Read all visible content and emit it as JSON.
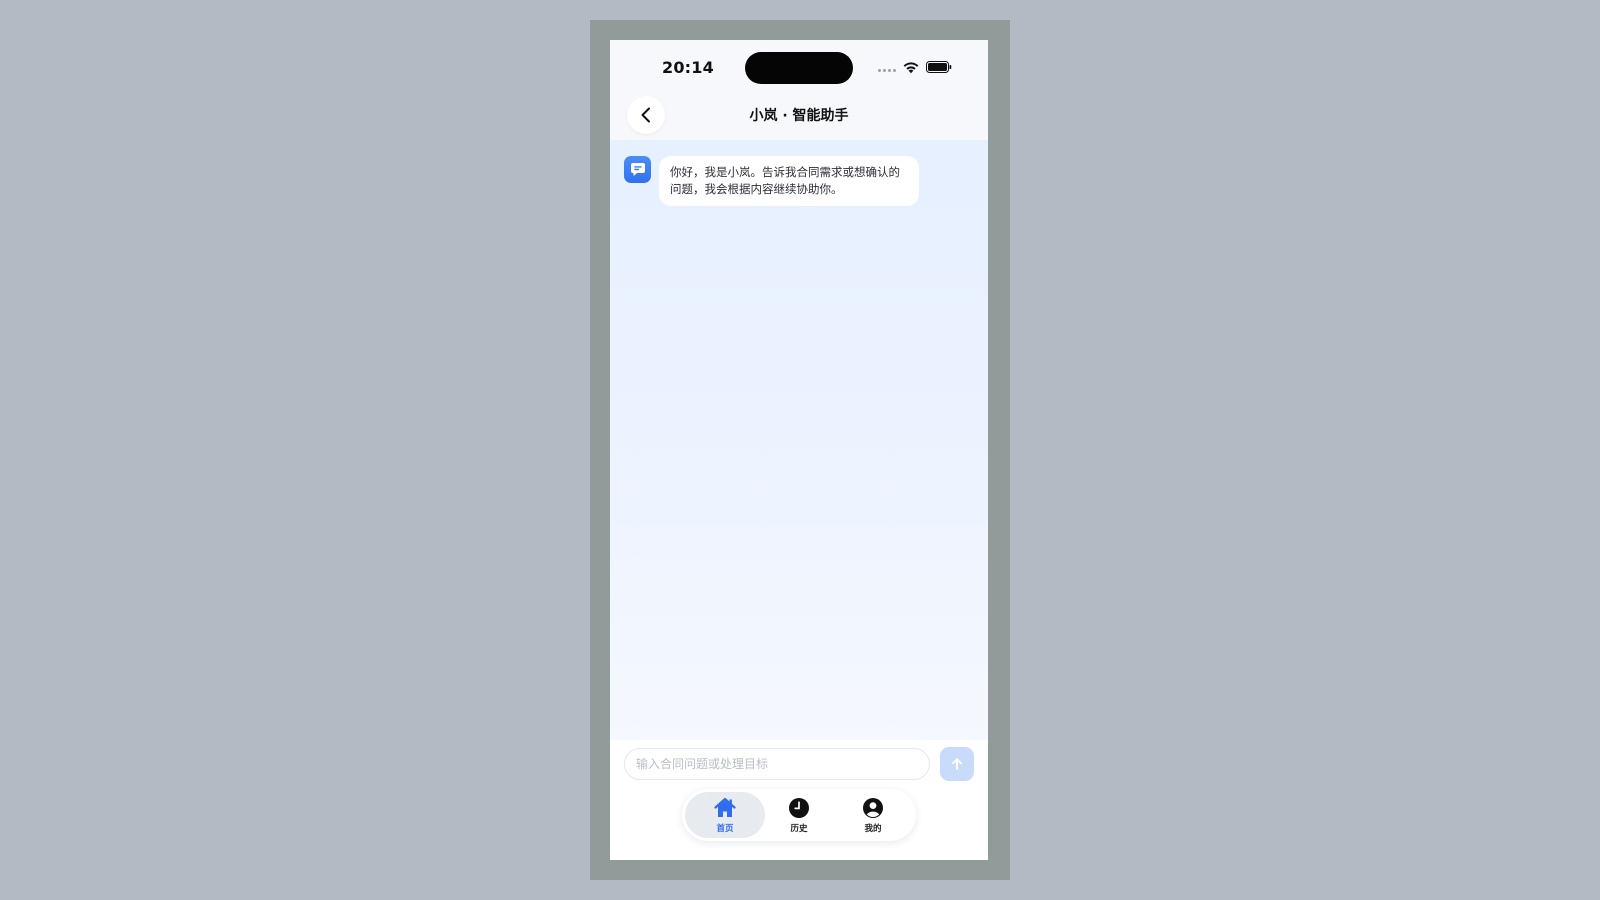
{
  "status_bar": {
    "time": "20:14",
    "icons": [
      "cellular-dots-icon",
      "wifi-icon",
      "battery-icon"
    ]
  },
  "header": {
    "title": "小岚 · 智能助手",
    "back_icon": "chevron-left-icon"
  },
  "chat": {
    "messages": [
      {
        "sender": "bot",
        "avatar_icon": "chat-bubble-icon",
        "text": "你好，我是小岚。告诉我合同需求或想确认的问题，我会根据内容继续协助你。"
      }
    ]
  },
  "composer": {
    "placeholder": "输入合同问题或处理目标",
    "value": "",
    "send_icon": "arrow-up-icon"
  },
  "tabs": [
    {
      "label": "首页",
      "icon": "home-icon",
      "active": true
    },
    {
      "label": "历史",
      "icon": "clock-icon",
      "active": false
    },
    {
      "label": "我的",
      "icon": "user-icon",
      "active": false
    }
  ],
  "colors": {
    "accent": "#2f6cf0",
    "background": "#b2bac4",
    "frame": "#919c9a",
    "send_disabled": "#c9dbfb"
  }
}
